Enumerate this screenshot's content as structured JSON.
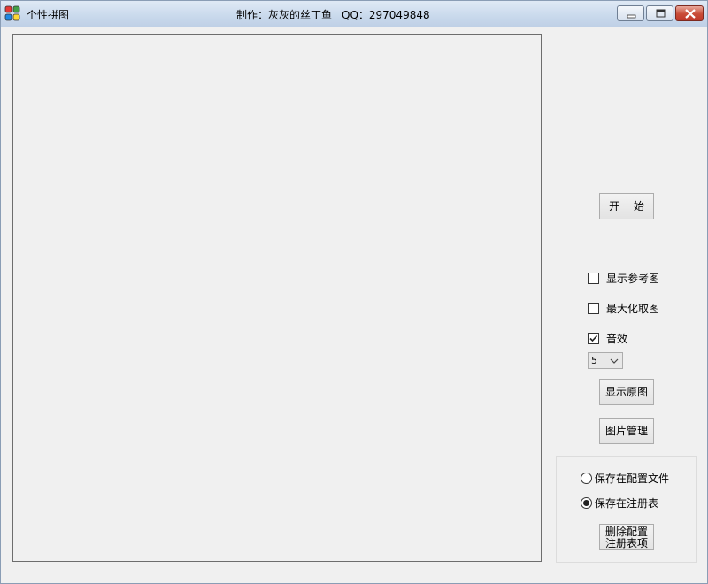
{
  "window": {
    "title": "个性拼图",
    "author_label": "制作：灰灰的丝丁鱼",
    "qq_label": "QQ：297049848",
    "icon": "puzzle-app-icon"
  },
  "controls": {
    "start_button": "开 始",
    "show_reference": {
      "label": "显示参考图",
      "checked": false
    },
    "maximize_capture": {
      "label": "最大化取图",
      "checked": false
    },
    "sound": {
      "label": "音效",
      "checked": true
    },
    "level_select": {
      "value": "5"
    },
    "show_original_button": "显示原图",
    "image_manage_button": "图片管理"
  },
  "storage": {
    "save_config_file": {
      "label": "保存在配置文件",
      "selected": false
    },
    "save_registry": {
      "label": "保存在注册表",
      "selected": true
    },
    "delete_button_line1": "删除配置",
    "delete_button_line2": "注册表项"
  },
  "colors": {
    "titlebar": "#c9d9ec",
    "close_button": "#c94c37",
    "background": "#f0f0f0"
  }
}
